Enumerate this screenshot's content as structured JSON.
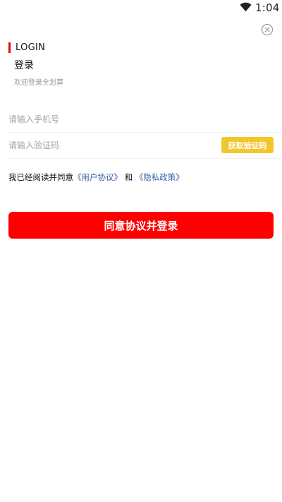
{
  "status_bar": {
    "time": "1:04",
    "wifi_icon": "wifi-icon"
  },
  "header": {
    "close_icon": "close-circle-icon",
    "title_en": "LOGIN",
    "title_cn": "登录",
    "welcome": "欢迎登录全划算"
  },
  "form": {
    "phone_placeholder": "请输入手机号",
    "phone_value": "",
    "code_placeholder": "请输入验证码",
    "code_value": "",
    "get_code_label": "获取验证码"
  },
  "agreement": {
    "prefix": "我已经阅读并同意",
    "user_agreement": "《用户协议》",
    "conjunction": " 和 ",
    "privacy_policy": "《隐私政策》"
  },
  "login_button_label": "同意协议并登录",
  "colors": {
    "accent": "#e20613",
    "primary_button": "#ff0000",
    "code_button": "#f2c72e",
    "link": "#3a5fa8"
  }
}
